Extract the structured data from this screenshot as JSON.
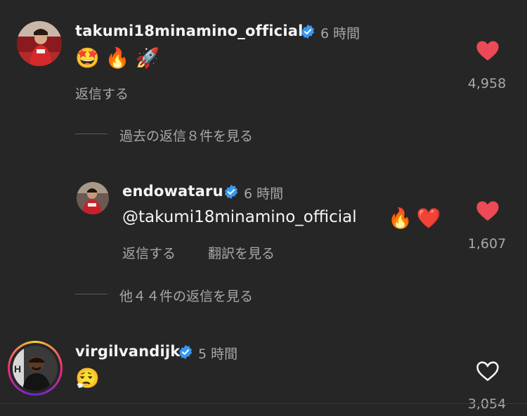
{
  "comments": [
    {
      "username": "takumi18minamino_official",
      "time": "6 時間",
      "emoji_text": "🤩🔥🚀",
      "reply_label": "返信する",
      "like_count": "4,958",
      "liked": true,
      "view_replies_label": "過去の返信８件を見る"
    },
    {
      "username": "endowataru",
      "time": "6 時間",
      "mention": "@takumi18minamino_official",
      "emoji_text": "🔥❤️",
      "reply_label": "返信する",
      "translate_label": "翻訳を見る",
      "like_count": "1,607",
      "liked": true,
      "view_replies_label": "他４４件の返信を見る"
    },
    {
      "username": "virgilvandijk",
      "time": "5 時間",
      "emoji_text": "😮‍💨",
      "like_count": "3,054",
      "liked": false
    }
  ],
  "colors": {
    "background": "#262626",
    "heart_red": "#ed4956",
    "verified_blue": "#3897f0",
    "secondary_text": "#a8a8a8"
  }
}
